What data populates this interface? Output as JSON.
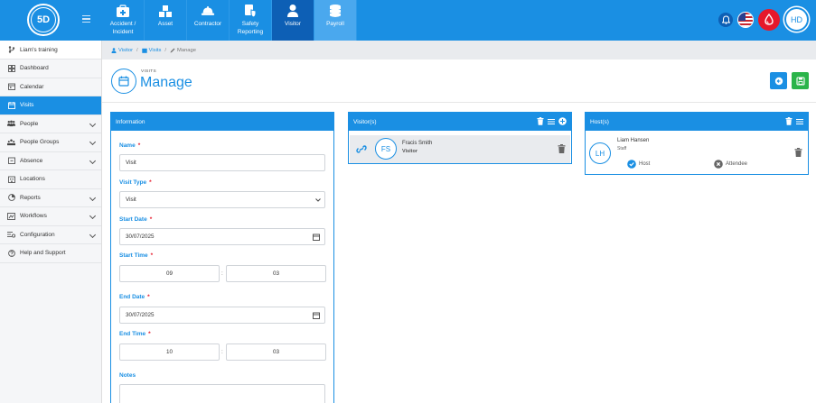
{
  "logo": {
    "text": "5D"
  },
  "nav": [
    {
      "label": "Accident / Incident",
      "icon": "first-aid-kit-icon"
    },
    {
      "label": "Asset",
      "icon": "boxes-icon"
    },
    {
      "label": "Contractor",
      "icon": "hard-hat-icon"
    },
    {
      "label": "Safety Reporting",
      "icon": "shield-doc-icon"
    },
    {
      "label": "Visitor",
      "icon": "person-icon"
    },
    {
      "label": "Payroll",
      "icon": "coins-icon"
    }
  ],
  "user": {
    "initials": "HD"
  },
  "sidebar": {
    "training": "Liam's training",
    "items": [
      {
        "label": "Dashboard",
        "icon": "dashboard-icon",
        "chevron": false
      },
      {
        "label": "Calendar",
        "icon": "calendar-icon",
        "chevron": false
      },
      {
        "label": "Visits",
        "icon": "visits-icon",
        "chevron": false,
        "active": true
      },
      {
        "label": "People",
        "icon": "people-icon",
        "chevron": true
      },
      {
        "label": "People Groups",
        "icon": "people-groups-icon",
        "chevron": true
      },
      {
        "label": "Absence",
        "icon": "absence-icon",
        "chevron": true
      },
      {
        "label": "Locations",
        "icon": "locations-icon",
        "chevron": false
      },
      {
        "label": "Reports",
        "icon": "reports-icon",
        "chevron": true
      },
      {
        "label": "Workflows",
        "icon": "workflows-icon",
        "chevron": true
      },
      {
        "label": "Configuration",
        "icon": "configuration-icon",
        "chevron": true
      },
      {
        "label": "Help and Support",
        "icon": "help-icon",
        "chevron": false
      }
    ]
  },
  "breadcrumb": {
    "visitor": "Visitor",
    "visits": "Visits",
    "manage": "Manage",
    "sep": "/"
  },
  "header": {
    "subtitle": "VISITS",
    "title": "Manage"
  },
  "information": {
    "heading": "Information",
    "name_label": "Name",
    "name_value": "Visit",
    "visit_type_label": "Visit Type",
    "visit_type_value": "Visit",
    "start_date_label": "Start Date",
    "start_date_value": "30/07/2025",
    "start_time_label": "Start Time",
    "start_hour": "09",
    "start_minute": "03",
    "end_date_label": "End Date",
    "end_date_value": "30/07/2025",
    "end_time_label": "End Time",
    "end_hour": "10",
    "end_minute": "03",
    "notes_label": "Notes",
    "required_mark": "*",
    "time_sep": ":"
  },
  "visitors": {
    "heading": "Visitor(s)",
    "items": [
      {
        "initials": "FS",
        "name": "Fracis Smith",
        "role": "Visitor"
      }
    ]
  },
  "hosts": {
    "heading": "Host(s)",
    "items": [
      {
        "initials": "LH",
        "name": "Liam Hansen",
        "role": "Staff",
        "host_label": "Host",
        "attendee_label": "Attendee"
      }
    ]
  },
  "colors": {
    "primary": "#1a8fe3",
    "active_nav": "#0d5fb5",
    "danger": "#e6182a",
    "success": "#2bb44a"
  }
}
